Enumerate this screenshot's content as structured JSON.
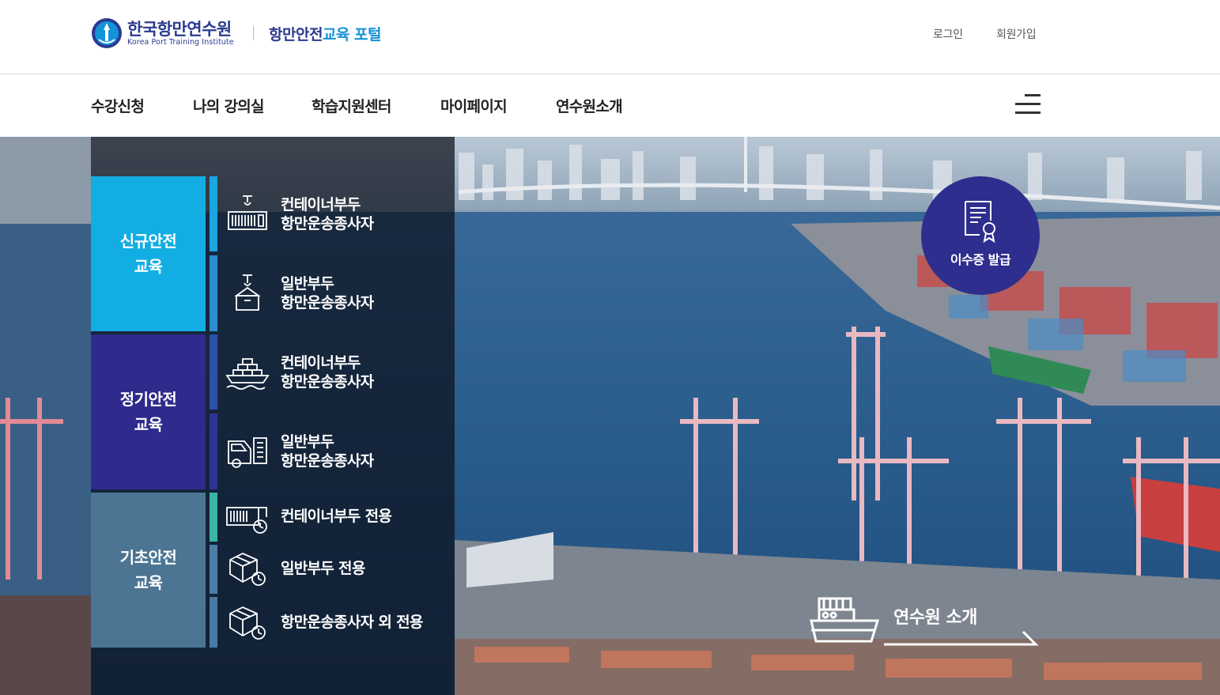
{
  "header": {
    "logo_ko": "한국항만연수원",
    "logo_en": "Korea Port Training Institute",
    "portal_main": "항만안전",
    "portal_highlight": "교육 포털",
    "login": "로그인",
    "signup": "회원가입"
  },
  "nav": {
    "items": [
      "수강신청",
      "나의 강의실",
      "학습지원센터",
      "마이페이지",
      "연수원소개"
    ]
  },
  "hero": {
    "categories": [
      {
        "label": "신규안전\n교육",
        "color": "#12aee3",
        "accent": "#1a9bd6"
      },
      {
        "label": "정기안전\n교육",
        "color": "#2f2b8c",
        "accent": "#2c51a8"
      },
      {
        "label": "기초안전\n교육",
        "color": "#4c7594",
        "accent": "#3fb5a8"
      }
    ],
    "courses": [
      {
        "label": "컨테이너부두\n항만운송종사자",
        "icon": "container-crane-icon"
      },
      {
        "label": "일반부두\n항만운송종사자",
        "icon": "cargo-crane-icon"
      },
      {
        "label": "컨테이너부두\n항만운송종사자",
        "icon": "container-ship-icon"
      },
      {
        "label": "일반부두\n항만운송종사자",
        "icon": "truck-cargo-icon"
      },
      {
        "label": "컨테이너부두 전용",
        "icon": "container-clock-icon"
      },
      {
        "label": "일반부두 전용",
        "icon": "box-clock-icon"
      },
      {
        "label": "항만운송종사자 외 전용",
        "icon": "box-clock-icon"
      }
    ],
    "certificate_label": "이수증 발급",
    "intro_label": "연수원 소개"
  },
  "colors": {
    "brand_navy": "#2a3a8f",
    "brand_blue": "#1593d8",
    "cert_bg": "#2d2e8d"
  }
}
